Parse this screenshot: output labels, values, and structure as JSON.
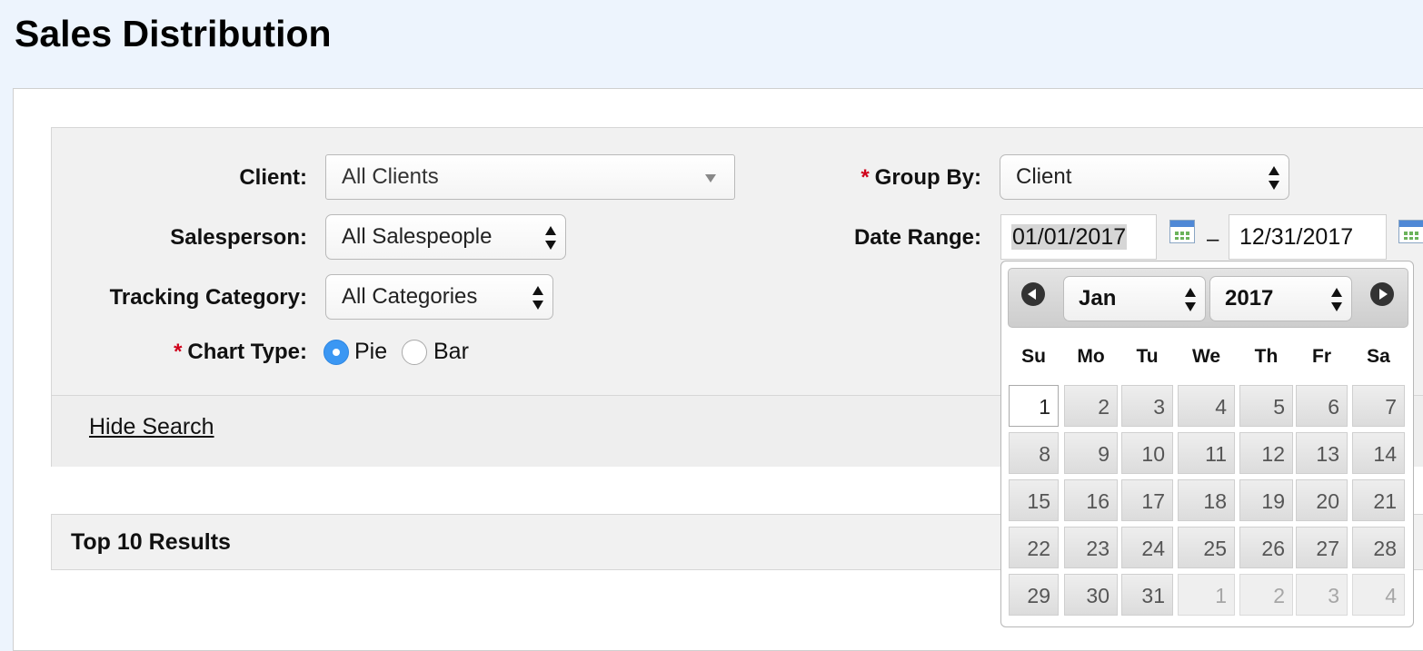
{
  "page": {
    "title": "Sales Distribution"
  },
  "form": {
    "client": {
      "label": "Client:",
      "value": "All Clients"
    },
    "salesperson": {
      "label": "Salesperson:",
      "value": "All Salespeople"
    },
    "tracking_category": {
      "label": "Tracking Category:",
      "value": "All Categories"
    },
    "chart_type": {
      "label": "Chart Type:",
      "required_mark": "*",
      "options": [
        {
          "label": "Pie",
          "selected": true
        },
        {
          "label": "Bar",
          "selected": false
        }
      ]
    },
    "group_by": {
      "label": "Group By:",
      "required_mark": "*",
      "value": "Client"
    },
    "date_range": {
      "label": "Date Range:",
      "start": "01/01/2017",
      "end": "12/31/2017",
      "separator": "–"
    },
    "hide_search": "Hide Search"
  },
  "datepicker": {
    "month": "Jan",
    "year": "2017",
    "weekdays": [
      "Su",
      "Mo",
      "Tu",
      "We",
      "Th",
      "Fr",
      "Sa"
    ],
    "weeks": [
      [
        "1",
        "2",
        "3",
        "4",
        "5",
        "6",
        "7"
      ],
      [
        "8",
        "9",
        "10",
        "11",
        "12",
        "13",
        "14"
      ],
      [
        "15",
        "16",
        "17",
        "18",
        "19",
        "20",
        "21"
      ],
      [
        "22",
        "23",
        "24",
        "25",
        "26",
        "27",
        "28"
      ],
      [
        "29",
        "30",
        "31",
        "1",
        "2",
        "3",
        "4"
      ]
    ],
    "selected_day": "1"
  },
  "results": {
    "title": "Top 10 Results"
  },
  "colors": {
    "accent": "#3b97f3",
    "required": "#d0021b",
    "header_bg": "#edf4fd"
  }
}
